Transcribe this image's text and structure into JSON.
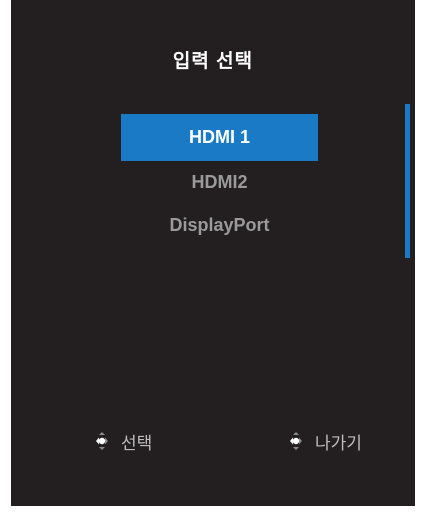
{
  "menu": {
    "title": "입력 선택",
    "items": [
      {
        "label": "HDMI 1",
        "selected": true
      },
      {
        "label": "HDMI2",
        "selected": false
      },
      {
        "label": "DisplayPort",
        "selected": false
      }
    ]
  },
  "hints": {
    "select": {
      "icon": "joystick-left-icon",
      "label": "선택"
    },
    "back": {
      "icon": "joystick-left-icon",
      "label": "나가기"
    }
  },
  "colors": {
    "background": "#231f20",
    "highlight": "#1a7ac5",
    "text": "#ffffff",
    "dim_text": "#9a9a9a"
  }
}
